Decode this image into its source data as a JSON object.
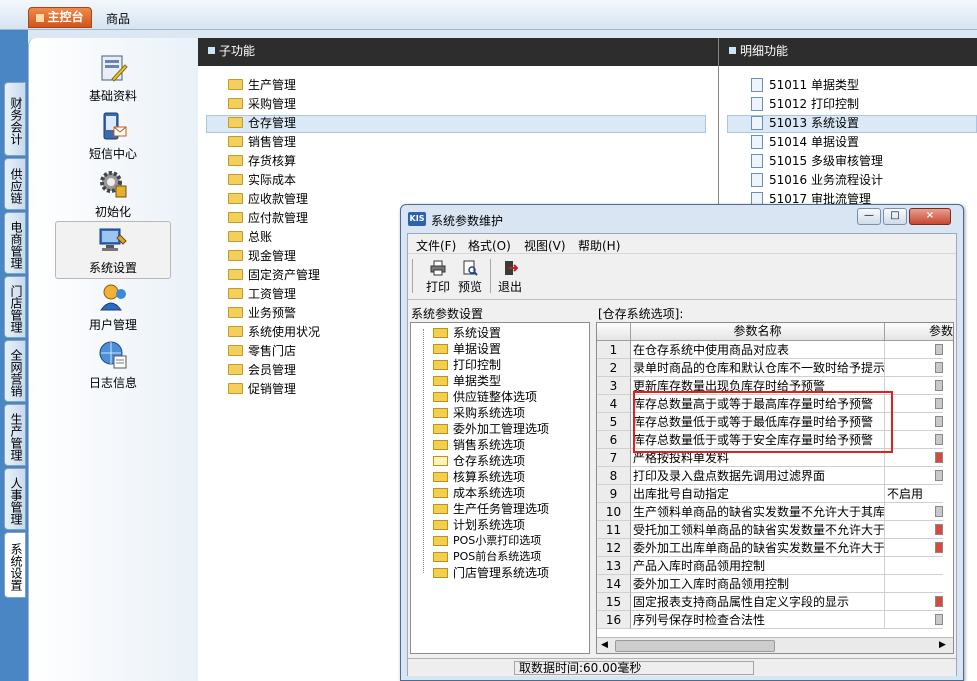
{
  "topbar": {
    "active_tab": "主控台",
    "tab": "商品"
  },
  "side_tabs": [
    "财务会计",
    "供应链",
    "电商管理",
    "门店管理",
    "全网营销",
    "生产管理",
    "人事管理",
    "系统设置"
  ],
  "modules": [
    "基础资料",
    "短信中心",
    "初始化",
    "系统设置",
    "用户管理",
    "日志信息"
  ],
  "sub_header": "子功能",
  "detail_header": "明细功能",
  "sub_items": [
    "生产管理",
    "采购管理",
    "仓存管理",
    "销售管理",
    "存货核算",
    "实际成本",
    "应收款管理",
    "应付款管理",
    "总账",
    "现金管理",
    "固定资产管理",
    "工资管理",
    "业务预警",
    "系统使用状况",
    "零售门店",
    "会员管理",
    "促销管理"
  ],
  "detail_items": [
    {
      "code": "51011",
      "name": "单据类型"
    },
    {
      "code": "51012",
      "name": "打印控制"
    },
    {
      "code": "51013",
      "name": "系统设置"
    },
    {
      "code": "51014",
      "name": "单据设置"
    },
    {
      "code": "51015",
      "name": "多级审核管理"
    },
    {
      "code": "51016",
      "name": "业务流程设计"
    },
    {
      "code": "51017",
      "name": "审批流管理"
    }
  ],
  "dialog": {
    "logo": "KIS",
    "title": "系统参数维护",
    "buttons": {
      "minimize": "—",
      "maximize": "□",
      "close": "×"
    },
    "menus": [
      "文件(F)",
      "格式(O)",
      "视图(V)",
      "帮助(H)"
    ],
    "tools": {
      "print": "打印",
      "preview": "预览",
      "exit": "退出"
    },
    "tree_label": "系统参数设置",
    "grid_label": "[仓存系统选项]:",
    "tree": [
      "系统设置",
      "单据设置",
      "打印控制",
      "单据类型",
      "供应链整体选项",
      "采购系统选项",
      "委外加工管理选项",
      "销售系统选项",
      "仓存系统选项",
      "核算系统选项",
      "成本系统选项",
      "生产任务管理选项",
      "计划系统选项",
      "POS小票打印选项",
      "POS前台系统选项",
      "门店管理系统选项"
    ],
    "grid_headers": {
      "name": "参数名称",
      "value": "参数"
    },
    "rows": [
      {
        "n": "1",
        "name": "在仓存系统中使用商品对应表",
        "value": "",
        "flag": "gray"
      },
      {
        "n": "2",
        "name": "录单时商品的仓库和默认仓库不一致时给予提示",
        "value": "",
        "flag": "gray"
      },
      {
        "n": "3",
        "name": "更新库存数量出现负库存时给予预警",
        "value": "",
        "flag": "gray"
      },
      {
        "n": "4",
        "name": "库存总数量高于或等于最高库存量时给予预警",
        "value": "",
        "flag": "gray"
      },
      {
        "n": "5",
        "name": "库存总数量低于或等于最低库存量时给予预警",
        "value": "",
        "flag": "gray"
      },
      {
        "n": "6",
        "name": "库存总数量低于或等于安全库存量时给予预警",
        "value": "",
        "flag": "gray"
      },
      {
        "n": "7",
        "name": "严格按投料单发料",
        "value": "",
        "flag": "red"
      },
      {
        "n": "8",
        "name": "打印及录入盘点数据先调用过滤界面",
        "value": "",
        "flag": "gray"
      },
      {
        "n": "9",
        "name": "出库批号自动指定",
        "value": "不启用",
        "flag": ""
      },
      {
        "n": "10",
        "name": "生产领料单商品的缺省实发数量不允许大于其库",
        "value": "",
        "flag": "gray"
      },
      {
        "n": "11",
        "name": "受托加工领料单商品的缺省实发数量不允许大于",
        "value": "",
        "flag": "red"
      },
      {
        "n": "12",
        "name": "委外加工出库单商品的缺省实发数量不允许大于",
        "value": "",
        "flag": "red"
      },
      {
        "n": "13",
        "name": "产品入库时商品领用控制",
        "value": "",
        "flag": ""
      },
      {
        "n": "14",
        "name": "委外加工入库时商品领用控制",
        "value": "",
        "flag": ""
      },
      {
        "n": "15",
        "name": "固定报表支持商品属性自定义字段的显示",
        "value": "",
        "flag": "red"
      },
      {
        "n": "16",
        "name": "序列号保存时检查合法性",
        "value": "",
        "flag": "gray"
      }
    ],
    "status": "取数据时间:60.00毫秒"
  },
  "colors": {
    "accent": "#d2541b",
    "header_bg": "#2d2d2d",
    "highlight_border": "#e02020"
  }
}
